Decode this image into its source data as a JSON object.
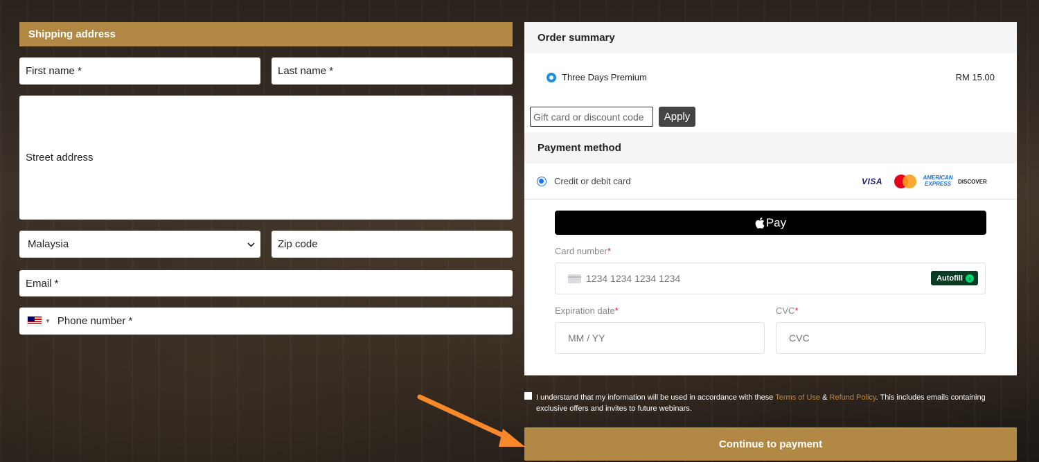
{
  "shipping": {
    "title": "Shipping address",
    "first_name_placeholder": "First name *",
    "last_name_placeholder": "Last name *",
    "street_placeholder": "Street address",
    "country_value": "Malaysia",
    "zip_placeholder": "Zip code",
    "email_placeholder": "Email *",
    "phone_placeholder": "Phone number *",
    "phone_flag": "malaysia-flag-icon"
  },
  "order_summary": {
    "title": "Order summary",
    "product_name": "Three Days Premium",
    "product_price": "RM 15.00",
    "discount_placeholder": "Gift card or discount code",
    "apply_label": "Apply"
  },
  "payment": {
    "title": "Payment method",
    "method_label": "Credit or debit card",
    "brands": [
      "VISA",
      "mastercard-icon",
      "AMERICAN EXPRESS",
      "DISCOVER"
    ],
    "applepay_label": "Pay",
    "card_number_label": "Card number",
    "card_number_placeholder": "1234 1234 1234 1234",
    "autofill_label": "Autofill",
    "expiry_label": "Expiration date",
    "expiry_placeholder": "MM / YY",
    "cvc_label": "CVC",
    "cvc_placeholder": "CVC",
    "required_mark": "*"
  },
  "consent": {
    "text_before": "I understand that my information will be used in accordance with these ",
    "terms_link": "Terms of Use",
    "amp": " & ",
    "refund_link": "Refund Policy",
    "text_after": ". This includes emails containing exclusive offers and invites to future webinars."
  },
  "cta": {
    "continue_label": "Continue to payment"
  },
  "colors": {
    "accent": "#b28845",
    "arrow": "#f7892b",
    "link": "#c4893e"
  }
}
